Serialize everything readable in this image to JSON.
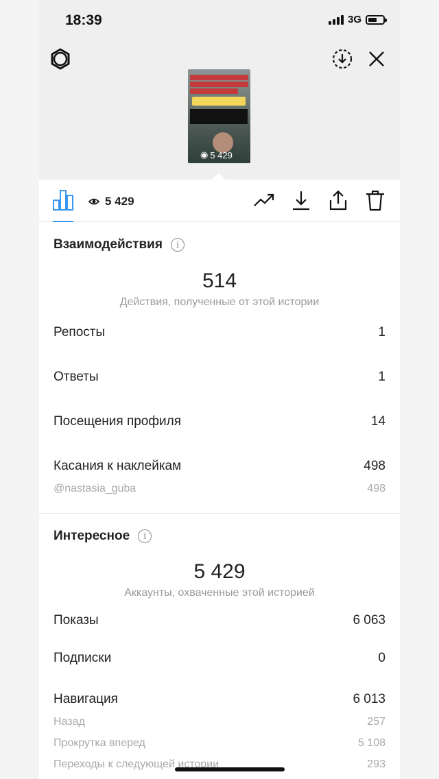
{
  "status_bar": {
    "time": "18:39",
    "network": "3G"
  },
  "story": {
    "thumb_views": "5 429",
    "caption_lines": [
      "Пошаговая инструкция",
      "как заработать на",
      "новой профессии за",
      "2 месяца"
    ],
    "tag": "@NASTASIA_GUBA",
    "overlay_lines": [
      "Пароли и явки где",
      "учиться бесплатно"
    ]
  },
  "toolbar": {
    "views": "5 429"
  },
  "interactions": {
    "title": "Взаимодействия",
    "total": "514",
    "subtitle": "Действия, полученные от этой истории",
    "rows": [
      {
        "label": "Репосты",
        "value": "1"
      },
      {
        "label": "Ответы",
        "value": "1"
      },
      {
        "label": "Посещения профиля",
        "value": "14"
      },
      {
        "label": "Касания к наклейкам",
        "value": "498"
      }
    ],
    "sticker_sub": {
      "label": "@nastasia_guba",
      "value": "498"
    }
  },
  "discovery": {
    "title": "Интересное",
    "total": "5 429",
    "subtitle": "Аккаунты, охваченные этой историей",
    "rows": [
      {
        "label": "Показы",
        "value": "6 063"
      },
      {
        "label": "Подписки",
        "value": "0"
      },
      {
        "label": "Навигация",
        "value": "6 013"
      }
    ],
    "navigation_sub": [
      {
        "label": "Назад",
        "value": "257"
      },
      {
        "label": "Прокрутка вперед",
        "value": "5 108"
      },
      {
        "label": "Переходы к следующей истории",
        "value": "293"
      }
    ]
  },
  "colors": {
    "accent": "#3897f0",
    "muted": "#9a9a9a"
  }
}
